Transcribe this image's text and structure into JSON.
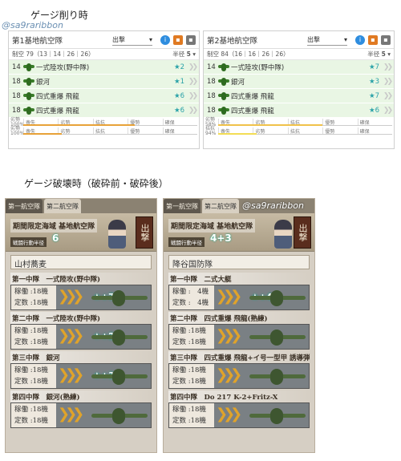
{
  "page": {
    "section1_title": "ゲージ削り時",
    "section2_title": "ゲージ破壊時（破砕前・破砕後）",
    "watermark": "@sa9raribbon"
  },
  "top_panels": [
    {
      "name": "第1基地航空隊",
      "action": "出撃",
      "air": "制空 79（13｜14｜26｜26）",
      "radius_label": "半径",
      "radius": "5",
      "slots": [
        {
          "count": "14",
          "name": "一式陸攻(野中隊)",
          "star": "★2"
        },
        {
          "count": "18",
          "name": "銀河",
          "star": "★1"
        },
        {
          "count": "18",
          "name": "四式重爆 飛龍",
          "star": "★6"
        },
        {
          "count": "18",
          "name": "四式重爆 飛龍",
          "star": "★6"
        }
      ],
      "rows": [
        {
          "label_top": "劣勢",
          "label_bot": "100%",
          "cells": [
            "喪失",
            "劣勢",
            "拮抗",
            "優勢",
            "確保"
          ],
          "fill_color": "#e8a238",
          "fill_fraction": 0.64
        },
        {
          "label_top": "劣勢",
          "label_bot": "100%",
          "cells": [
            "喪失",
            "劣勢",
            "拮抗",
            "優勢",
            "確保"
          ],
          "fill_color": "#e8a238",
          "fill_fraction": 0.22
        }
      ]
    },
    {
      "name": "第2基地航空隊",
      "action": "出撃",
      "air": "制空 84（16｜16｜26｜26）",
      "radius_label": "半径",
      "radius": "5",
      "slots": [
        {
          "count": "14",
          "name": "一式陸攻(野中隊)",
          "star": "★7"
        },
        {
          "count": "18",
          "name": "銀河",
          "star": "★3"
        },
        {
          "count": "18",
          "name": "四式重爆 飛龍",
          "star": "★7"
        },
        {
          "count": "18",
          "name": "四式重爆 飛龍",
          "star": "★6"
        }
      ],
      "rows": [
        {
          "label_top": "劣勢",
          "label_bot": "58%",
          "cells": [
            "喪失",
            "劣勢",
            "拮抗",
            "優勢",
            "確保"
          ],
          "fill_color": "#f0c24a",
          "fill_fraction": 0.6
        },
        {
          "label_top": "拮抗",
          "label_bot": "94%",
          "cells": [
            "喪失",
            "劣勢",
            "拮抗",
            "優勢",
            "確保"
          ],
          "fill_color": "#f3dd55",
          "fill_fraction": 0.22
        }
      ]
    }
  ],
  "game_panels": [
    {
      "tabs": [
        "第一航空隊",
        "第二航空隊"
      ],
      "banner_title": "期間限定海域 基地航空隊",
      "banner_sub": "戦闘行動半径",
      "banner_num": "6",
      "sortie": "出撃",
      "corps_name": "山村蕎麦",
      "squadrons": [
        {
          "header": "第一中隊　一式陸攻(野中隊)",
          "active": "稼働 :18機",
          "fixed": "定数 :18機",
          "star": "★+7"
        },
        {
          "header": "第二中隊　一式陸攻(野中隊)",
          "active": "稼働 :18機",
          "fixed": "定数 :18機",
          "star": "★+2"
        },
        {
          "header": "第三中隊　銀河",
          "active": "稼働 :18機",
          "fixed": "定数 :18機",
          "star": "★+3"
        },
        {
          "header": "第四中隊　銀河(熟練)",
          "active": "稼働 :18機",
          "fixed": "定数 :18機",
          "star": ""
        }
      ]
    },
    {
      "tabs": [
        "第一航空隊",
        "第二航空隊"
      ],
      "banner_title": "期間限定海域 基地航空隊",
      "banner_sub": "戦闘行動半径",
      "banner_num": "4+3",
      "sortie": "出撃",
      "corps_name": "降谷国防隊",
      "squadrons": [
        {
          "header": "第一中隊　二式大艇",
          "active": "稼働 :　4機",
          "fixed": "定数 :　4機",
          "star": "★+4"
        },
        {
          "header": "第二中隊　四式重爆 飛龍(熟練)",
          "active": "稼働 :18機",
          "fixed": "定数 :18機",
          "star": ""
        },
        {
          "header": "第三中隊　四式重爆 飛龍+イ号一型甲 誘導弾",
          "active": "稼働 :18機",
          "fixed": "定数 :18機",
          "star": ""
        },
        {
          "header": "第四中隊　Do 217 K-2+Fritz-X",
          "active": "稼働 :18機",
          "fixed": "定数 :18機",
          "star": ""
        }
      ]
    }
  ]
}
